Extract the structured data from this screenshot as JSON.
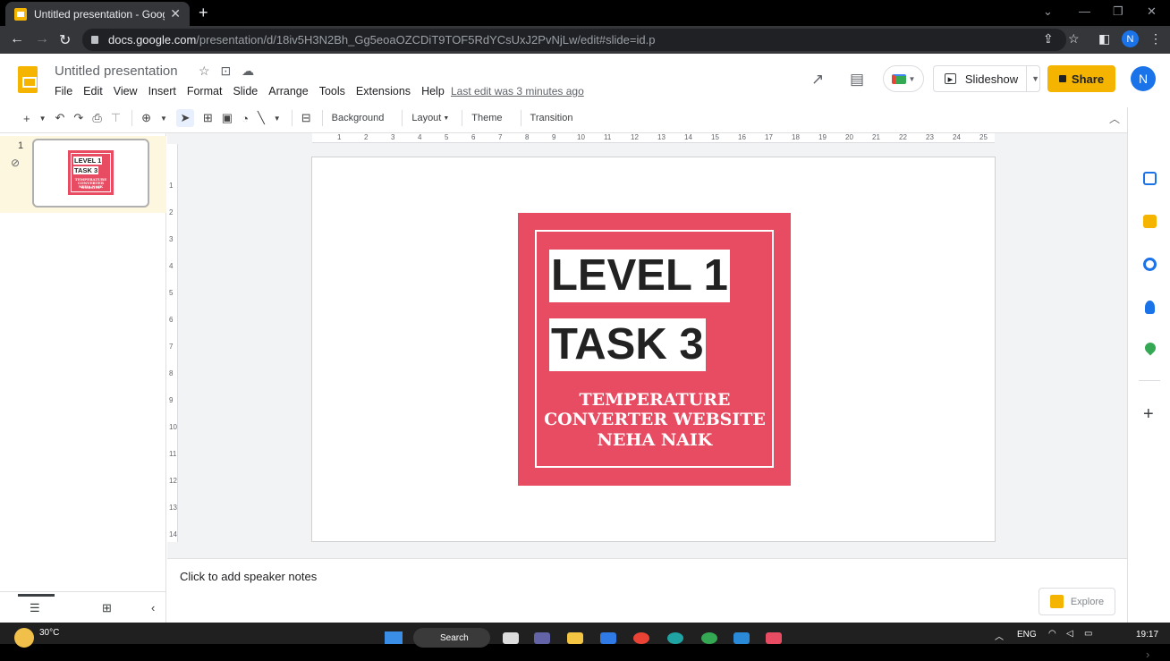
{
  "browser": {
    "tab_title": "Untitled presentation - Google S",
    "url_host": "docs.google.com",
    "url_path": "/presentation/d/18iv5H3N2Bh_Gg5eoaOZCDiT9TOF5RdYCsUxJ2PvNjLw/edit#slide=id.p",
    "profile_initial": "N"
  },
  "app": {
    "doc_title": "Untitled presentation",
    "menu": [
      "File",
      "Edit",
      "View",
      "Insert",
      "Format",
      "Slide",
      "Arrange",
      "Tools",
      "Extensions",
      "Help"
    ],
    "last_edit": "Last edit was 3 minutes ago",
    "slideshow_label": "Slideshow",
    "share_label": "Share",
    "avatar_initial": "N",
    "toolbar_text": {
      "background": "Background",
      "layout": "Layout",
      "theme": "Theme",
      "transition": "Transition"
    }
  },
  "filmstrip": {
    "slide_number": "1",
    "thumb_line1": "LEVEL 1",
    "thumb_line2": "TASK 3",
    "thumb_sub1": "TEMPERATURE",
    "thumb_sub2": "CONVERTER WEBSITE",
    "thumb_sub3": "NEHA NAIK"
  },
  "slide": {
    "line1": "LEVEL 1",
    "line2": "TASK 3",
    "subtitle1": "TEMPERATURE",
    "subtitle2": "CONVERTER WEBSITE",
    "subtitle3": "NEHA NAIK",
    "card_color": "#e84c63"
  },
  "ruler": {
    "h": [
      "1",
      "2",
      "3",
      "4",
      "5",
      "6",
      "7",
      "8",
      "9",
      "10",
      "11",
      "12",
      "13",
      "14",
      "15",
      "16",
      "17",
      "18",
      "19",
      "20",
      "21",
      "22",
      "23",
      "24",
      "25"
    ],
    "v": [
      "1",
      "2",
      "3",
      "4",
      "5",
      "6",
      "7",
      "8",
      "9",
      "10",
      "11",
      "12",
      "13",
      "14"
    ]
  },
  "notes": {
    "placeholder": "Click to add speaker notes",
    "explore_label": "Explore"
  },
  "taskbar": {
    "temperature": "30°C",
    "search_label": "Search",
    "lang": "ENG",
    "time": "19:17"
  },
  "colors": {
    "accent_yellow": "#f4b400",
    "accent_blue": "#1a73e8"
  }
}
